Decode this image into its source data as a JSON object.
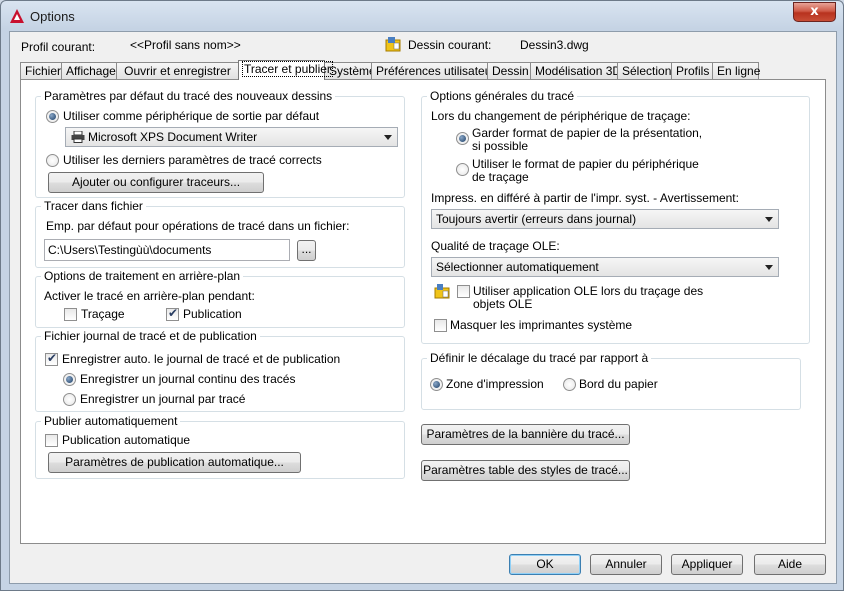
{
  "window": {
    "title": "Options",
    "close_glyph": "x"
  },
  "profile": {
    "label": "Profil courant:",
    "value": "<<Profil sans nom>>",
    "drawing_label": "Dessin courant:",
    "drawing_value": "Dessin3.dwg"
  },
  "tabs": [
    "Fichiers",
    "Affichage",
    "Ouvrir et enregistrer",
    "Tracer et publier",
    "Système",
    "Préférences utilisateur",
    "Dessin",
    "Modélisation 3D",
    "Sélection",
    "Profils",
    "En ligne"
  ],
  "active_tab": "Tracer et publier",
  "default_plot": {
    "title": "Paramètres par défaut du tracé des nouveaux dessins",
    "use_device_label": "Utiliser comme périphérique de sortie par défaut",
    "use_device_checked": true,
    "device_value": "Microsoft XPS Document Writer",
    "use_last_label": "Utiliser les derniers paramètres de tracé corrects",
    "use_last_checked": false,
    "add_plotters_button": "Ajouter ou configurer traceurs..."
  },
  "plot_to_file": {
    "title": "Tracer dans fichier",
    "location_label": "Emp. par défaut pour opérations de tracé dans un fichier:",
    "location_value": "C:\\Users\\Testingùù\\documents",
    "browse_button": "..."
  },
  "background": {
    "title": "Options de traitement en arrière-plan",
    "enable_label": "Activer le tracé en arrière-plan pendant:",
    "plotting_label": "Traçage",
    "plotting_checked": false,
    "publishing_label": "Publication",
    "publishing_checked": true
  },
  "log": {
    "title": "Fichier journal de tracé et de publication",
    "auto_save_label": "Enregistrer auto. le journal de tracé et de publication",
    "auto_save_checked": true,
    "continuous_label": "Enregistrer un journal continu des tracés",
    "continuous_checked": true,
    "per_plot_label": "Enregistrer un journal par tracé",
    "per_plot_checked": false
  },
  "auto_publish": {
    "title": "Publier automatiquement",
    "auto_label": "Publication automatique",
    "auto_checked": false,
    "settings_button": "Paramètres de publication automatique..."
  },
  "general": {
    "title": "Options générales du tracé",
    "device_change_label": "Lors du changement de périphérique de traçage:",
    "keep_layout_line1": "Garder format de papier de la présentation,",
    "keep_layout_line2": "si possible",
    "keep_layout_checked": true,
    "use_device_line1": "Utiliser le format de papier du périphérique",
    "use_device_line2": "de traçage",
    "use_device_checked": false,
    "spool_label": "Impress. en différé à partir de l'impr. syst. - Avertissement:",
    "spool_value": "Toujours avertir (erreurs dans journal)",
    "ole_quality_label": "Qualité de traçage OLE:",
    "ole_quality_value": "Sélectionner automatiquement",
    "ole_app_line1": "Utiliser application OLE lors du traçage des",
    "ole_app_line2": "objets OLE",
    "ole_app_checked": false,
    "hide_printers_label": "Masquer les imprimantes système",
    "hide_printers_checked": false
  },
  "offset": {
    "title": "Définir le décalage du tracé par rapport à",
    "printable_label": "Zone d'impression",
    "printable_checked": true,
    "edge_label": "Bord du papier",
    "edge_checked": false
  },
  "buttons": {
    "plot_stamp": "Paramètres de la bannière du tracé...",
    "plot_style": "Paramètres table des styles de tracé...",
    "ok": "OK",
    "cancel": "Annuler",
    "apply": "Appliquer",
    "help": "Aide"
  },
  "icons": {
    "app": "autocad-icon",
    "drawing": "drawing-file-icon",
    "printer": "printer-icon",
    "ole": "ole-object-icon"
  },
  "colors": {
    "app_icon": "#c8102e",
    "default_button_border": "#3c7fb1"
  }
}
